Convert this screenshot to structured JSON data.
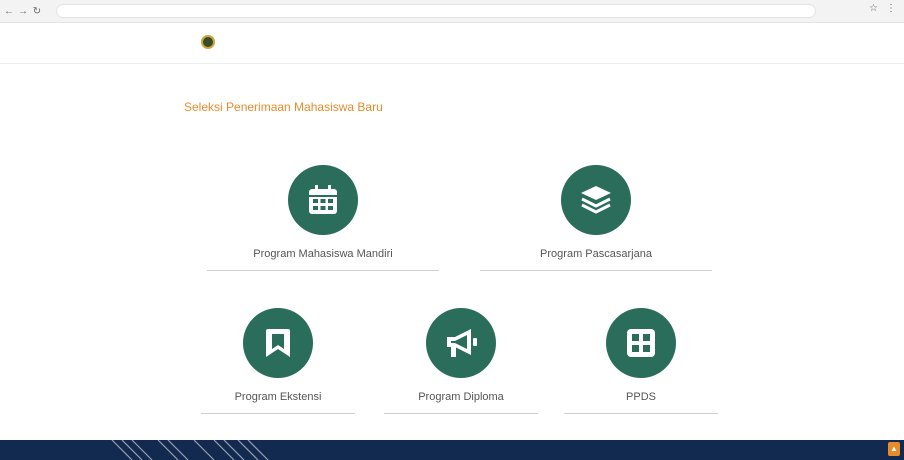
{
  "browser": {
    "back": "←",
    "forward": "→",
    "reload": "↻",
    "actions": [
      "☆",
      "⋮"
    ]
  },
  "header": {
    "logo_text": "",
    "nav": [
      {
        "label": ""
      },
      {
        "label": ""
      },
      {
        "label": ""
      }
    ]
  },
  "page": {
    "heading": "Seleksi Penerimaan Mahasiswa Baru"
  },
  "programs": [
    {
      "label": "Program Mahasiswa Mandiri",
      "icon": "calendar-icon"
    },
    {
      "label": "Program Pascasarjana",
      "icon": "layers-icon"
    },
    {
      "label": "Program Ekstensi",
      "icon": "bookmark-icon"
    },
    {
      "label": "Program Diploma",
      "icon": "megaphone-icon"
    },
    {
      "label": "PPDS",
      "icon": "grid-icon"
    }
  ],
  "colors": {
    "accent": "#e98b2a",
    "icon_bg": "#2a6d5a",
    "footer": "#132a50"
  }
}
